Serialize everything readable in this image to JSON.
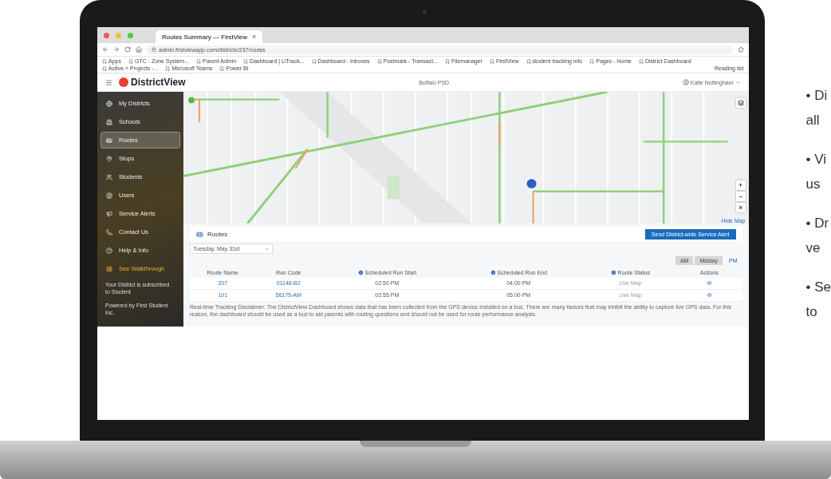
{
  "browser": {
    "tabs": [
      {
        "title": "Routes Summary — FirstView",
        "close": "×",
        "selected": true
      }
    ],
    "url": "admin.firstviewapp.com/districts/237/routes",
    "bookmarks": [
      "Apps",
      "GTC - Zone System...",
      "Parent Admin",
      "Dashboard | LiTrack...",
      "Dashboard - Inboxes",
      "Postmark - Transact...",
      "Filemanager",
      "FirstView",
      "student tracking info",
      "Pages - Home",
      "District Dashboard",
      "Active + Projects -...",
      "Microsoft Teams",
      "Power BI"
    ],
    "reading_list": "Reading list"
  },
  "header": {
    "logo": "DistrictView",
    "district": "Buffalo PSD",
    "user": "Katie Nottingham"
  },
  "sidebar": {
    "items": [
      {
        "label": "My Districts",
        "selected": false,
        "kind": "nav"
      },
      {
        "label": "Schools",
        "selected": false,
        "kind": "nav"
      },
      {
        "label": "Routes",
        "selected": true,
        "kind": "nav"
      },
      {
        "label": "Stops",
        "selected": false,
        "kind": "nav"
      },
      {
        "label": "Students",
        "selected": false,
        "kind": "nav"
      },
      {
        "label": "Users",
        "selected": false,
        "kind": "nav"
      },
      {
        "label": "Service Alerts",
        "selected": false,
        "kind": "nav"
      },
      {
        "label": "Contact Us",
        "selected": false,
        "kind": "nav"
      },
      {
        "label": "Help & Info",
        "selected": false,
        "kind": "nav"
      },
      {
        "label": "See Walkthrough",
        "selected": false,
        "kind": "highlight"
      }
    ],
    "notice": "Your District is subscribed to Student",
    "powered": "Powered by First Student Inc."
  },
  "map": {
    "hide_label": "Hide Map",
    "controls": [
      "+",
      "−",
      "×"
    ]
  },
  "routes": {
    "title": "Routes",
    "alert_button": "Send District-wide Service Alert",
    "date": "Tuesday, May 31st",
    "periods": [
      {
        "label": "AM",
        "selected": false
      },
      {
        "label": "Midday",
        "selected": false
      },
      {
        "label": "PM",
        "selected": true
      }
    ],
    "columns": [
      {
        "label": "Route Name",
        "info": false
      },
      {
        "label": "Run Code",
        "info": false
      },
      {
        "label": "Scheduled Run Start",
        "info": true
      },
      {
        "label": "Scheduled Run End",
        "info": true
      },
      {
        "label": "Route Status",
        "info": true
      },
      {
        "label": "Actions",
        "info": false
      }
    ],
    "rows": [
      [
        "207",
        "01148-B2",
        "02:50 PM",
        "04:00 PM",
        "Live Map"
      ],
      [
        "101",
        "56175-AM",
        "02:55 PM",
        "05:00 PM",
        "Live Map"
      ]
    ],
    "disclaimer": "Real-time Tracking Disclaimer: The DistrictView Dashboard shows data that has been collected from the GPS device installed on a bus. There are many factors that may inhibit the ability to capture live GPS data. For this reason, the dashboard should be used as a tool to aid parents with routing questions and should not be used for route performance analysis."
  },
  "bullets": [
    {
      "mark": "•",
      "lines": [
        "Di",
        "all"
      ]
    },
    {
      "mark": "•",
      "lines": [
        "Vi",
        "us"
      ]
    },
    {
      "mark": "•",
      "lines": [
        "Dr",
        "ve"
      ]
    },
    {
      "mark": "•",
      "lines": [
        "Se",
        "to"
      ]
    }
  ]
}
